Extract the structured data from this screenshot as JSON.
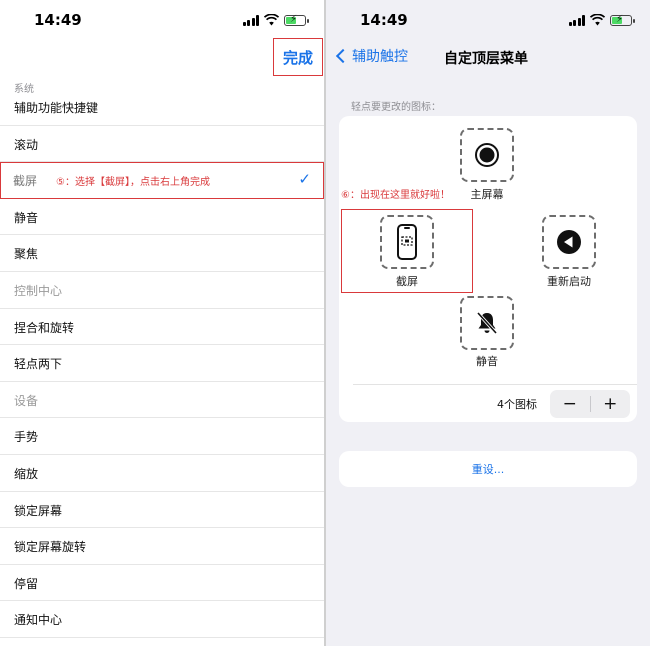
{
  "status": {
    "time": "14:49"
  },
  "left": {
    "done_label": "完成",
    "section_system": "系统",
    "rows": [
      {
        "label": "辅助功能快捷键"
      },
      {
        "label": "滚动"
      },
      {
        "label": "截屏",
        "annotation": "⑤：选择【截屏】，点击右上角完成",
        "checkmark": "✓"
      },
      {
        "label": "静音"
      },
      {
        "label": "聚焦"
      },
      {
        "label": "控制中心"
      },
      {
        "label": "捏合和旋转"
      },
      {
        "label": "轻点两下"
      },
      {
        "label": "设备"
      },
      {
        "label": "手势"
      },
      {
        "label": "缩放"
      },
      {
        "label": "锁定屏幕"
      },
      {
        "label": "锁定屏幕旋转"
      },
      {
        "label": "停留"
      },
      {
        "label": "通知中心"
      }
    ]
  },
  "right": {
    "back_label": "辅助触控",
    "nav_title": "自定顶层菜单",
    "hint": "轻点要更改的图标：",
    "annotation": "⑥：出现在这里就好啦！",
    "icons": {
      "home": "主屏幕",
      "screenshot": "截屏",
      "restart": "重新启动",
      "mute": "静音"
    },
    "count_label": "4个图标",
    "minus": "−",
    "plus": "+",
    "reset_label": "重设..."
  },
  "colors": {
    "accent": "#1a73e8",
    "annotation": "#d9393b"
  }
}
